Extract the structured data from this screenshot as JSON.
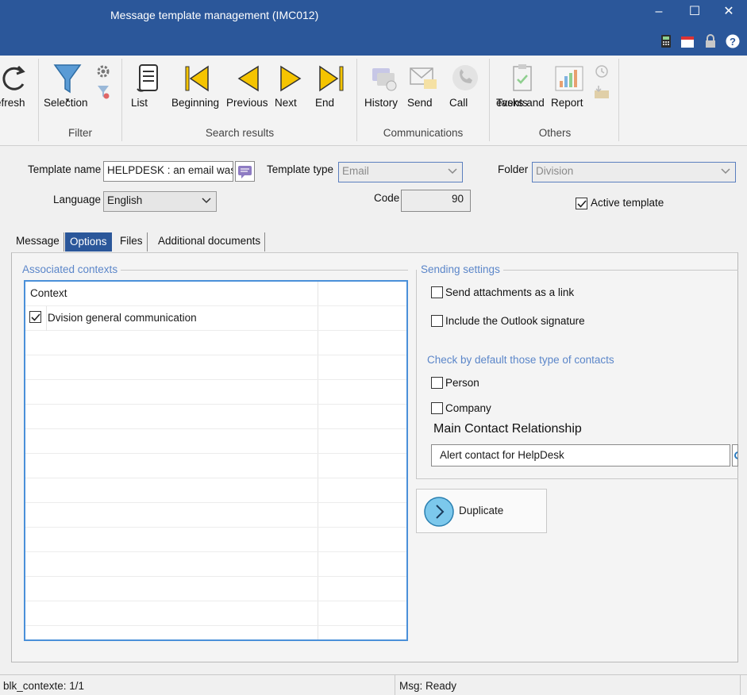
{
  "window": {
    "title": "Message template management (IMC012)",
    "minimize": "–",
    "maximize": "☐",
    "close": "✕"
  },
  "ribbon": {
    "refresh": "efresh",
    "selection": "Selection",
    "filter_group": "Filter",
    "list": "List",
    "beginning": "Beginning",
    "previous": "Previous",
    "next": "Next",
    "end": "End",
    "search_results_group": "Search results",
    "history": "History",
    "send": "Send",
    "call": "Call",
    "communications_group": "Communications",
    "tasks_events_1": "Tasks and",
    "tasks_events_2": "events",
    "report": "Report",
    "others_group": "Others"
  },
  "form": {
    "template_name_label": "Template name",
    "template_name_value": "HELPDESK : an email was p",
    "template_type_label": "Template type",
    "template_type_value": "Email",
    "folder_label": "Folder",
    "folder_value": "Division",
    "language_label": "Language",
    "language_value": "English",
    "code_label": "Code",
    "code_value": "90",
    "active_template_label": "Active template",
    "active_template_checked": true
  },
  "tabs": [
    "Message",
    "Options",
    "Files",
    "Additional documents"
  ],
  "active_tab": "Options",
  "associated_contexts": {
    "title": "Associated contexts",
    "column_header": "Context",
    "rows": [
      {
        "label": "Dvision general communication",
        "checked": true
      }
    ]
  },
  "sending_settings": {
    "title": "Sending settings",
    "send_attachments_link": "Send attachments as a link",
    "include_outlook_signature": "Include the Outlook signature",
    "check_default_title": "Check by default those type of contacts",
    "person": "Person",
    "company": "Company",
    "main_contact_label": "Main Contact Relationship",
    "main_contact_value": "Alert contact for HelpDesk"
  },
  "duplicate_button": "Duplicate",
  "status": {
    "left": "blk_contexte: 1/1",
    "right": "Msg: Ready"
  },
  "colors": {
    "titlebar": "#2b579a",
    "accent": "#4a90d9",
    "section": "#5b86c9",
    "arrow_yellow": "#f5c400"
  }
}
